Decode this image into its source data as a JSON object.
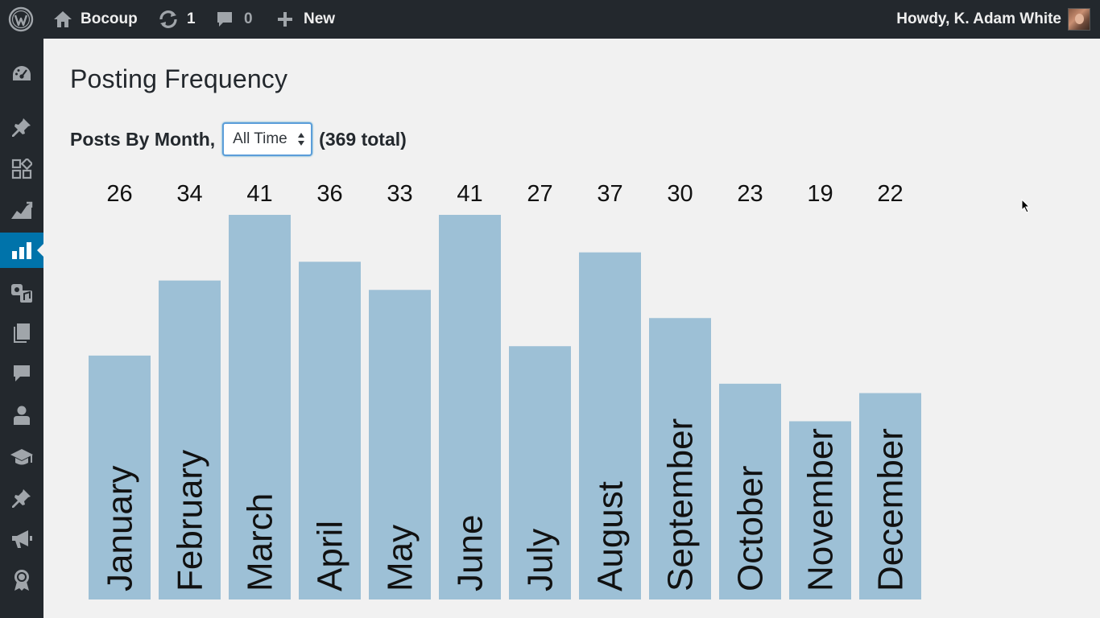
{
  "adminbar": {
    "site_name": "Bocoup",
    "updates_count": "1",
    "comments_count": "0",
    "new_label": "New",
    "greeting": "Howdy, K. Adam White"
  },
  "sidebar": {
    "items": [
      {
        "name": "dashboard-icon"
      },
      {
        "name": "posts-pin-icon"
      },
      {
        "name": "blocks-grid-icon"
      },
      {
        "name": "stats-chart-icon"
      },
      {
        "name": "bar-chart-icon",
        "current": true
      },
      {
        "name": "media-icon"
      },
      {
        "name": "pages-icon"
      },
      {
        "name": "comments-icon"
      },
      {
        "name": "users-icon"
      },
      {
        "name": "education-cap-icon"
      },
      {
        "name": "pin-icon"
      },
      {
        "name": "megaphone-icon"
      },
      {
        "name": "awards-icon"
      },
      {
        "name": "more-icon"
      }
    ]
  },
  "page": {
    "title": "Posting Frequency",
    "posts_by_label": "Posts By Month,",
    "range_value": "All Time",
    "total_label": "(369 total)"
  },
  "colors": {
    "bar": "#9dc0d6",
    "accent": "#0073aa",
    "adminbar_bg": "#23282d",
    "page_bg": "#f1f1f1"
  },
  "chart_data": {
    "type": "bar",
    "categories": [
      "January",
      "February",
      "March",
      "April",
      "May",
      "June",
      "July",
      "August",
      "September",
      "October",
      "November",
      "December"
    ],
    "values": [
      26,
      34,
      41,
      36,
      33,
      41,
      27,
      37,
      30,
      23,
      19,
      22
    ],
    "ylim": [
      0,
      41
    ],
    "category_labels": "rotated-inside-bars",
    "value_labels": "above-chart"
  }
}
